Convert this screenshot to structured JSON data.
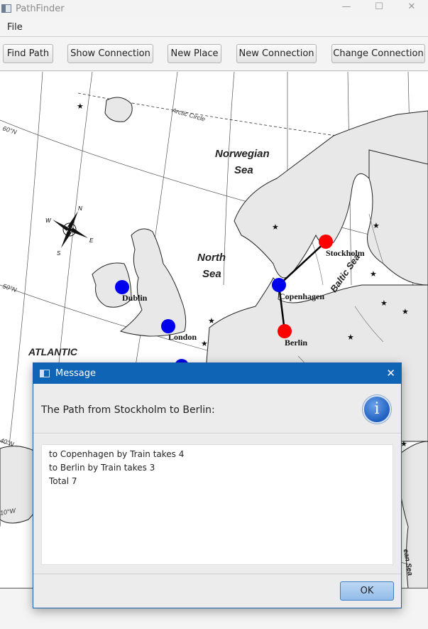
{
  "window": {
    "title": "PathFinder",
    "minimize": "—",
    "maximize": "☐",
    "close": "✕"
  },
  "menu": {
    "file": "File"
  },
  "toolbar": {
    "find_path": "Find Path",
    "show_connection": "Show Connection",
    "new_place": "New Place",
    "new_connection": "New Connection",
    "change_connection": "Change Connection"
  },
  "map": {
    "labels": {
      "norwegian_sea_1": "Norwegian",
      "norwegian_sea_2": "Sea",
      "north_sea_1": "North",
      "north_sea_2": "Sea",
      "baltic_sea": "Baltic Sea",
      "atlantic": "ATLANTIC",
      "arctic_circle": "Arctic Circle",
      "lat_60": "60°N",
      "lat_50": "50°N",
      "lat_40": "40°N",
      "lon_10w": "10°W",
      "compass_n": "N",
      "compass_s": "S",
      "compass_e": "E",
      "compass_w": "W",
      "partial_sea": "ean Sea"
    },
    "places": [
      {
        "name": "Dublin",
        "color": "#0000ee",
        "selected": false
      },
      {
        "name": "London",
        "color": "#0000ee",
        "selected": false
      },
      {
        "name": "Copenhagen",
        "color": "#0000ee",
        "selected": false
      },
      {
        "name": "Stockholm",
        "color": "#ff0000",
        "selected": true
      },
      {
        "name": "Berlin",
        "color": "#ff0000",
        "selected": true
      }
    ],
    "connections": [
      {
        "from": "Stockholm",
        "to": "Copenhagen"
      },
      {
        "from": "Copenhagen",
        "to": "Berlin"
      }
    ]
  },
  "dialog": {
    "title": "Message",
    "close": "✕",
    "header": "The Path from Stockholm to Berlin:",
    "info_symbol": "i",
    "lines": [
      "to Copenhagen by Train takes 4",
      "to Berlin by Train takes 3",
      "Total 7"
    ],
    "ok": "OK"
  },
  "colors": {
    "dialog_title_bar": "#0f64b5",
    "selected_place": "#ff0000",
    "place": "#0000ee"
  }
}
